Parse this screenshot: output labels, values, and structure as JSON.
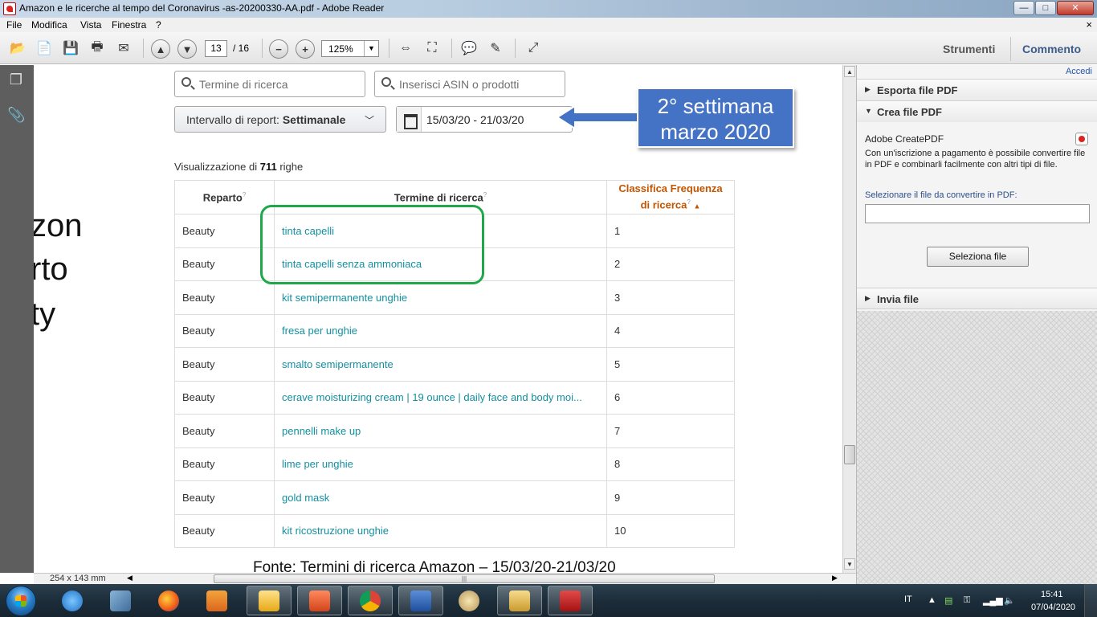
{
  "window": {
    "title": "Amazon e le ricerche al tempo del Coronavirus -as-20200330-AA.pdf - Adobe Reader",
    "controls": {
      "minimize": "—",
      "maximize": "□",
      "close": "✕"
    }
  },
  "menu": {
    "items": [
      "File",
      "Modifica",
      "Vista",
      "Finestra",
      "?"
    ],
    "close_glyph": "×"
  },
  "toolbar": {
    "page_current": "13",
    "page_total": "/ 16",
    "zoom": "125%",
    "tabs": {
      "tools": "Strumenti",
      "comment": "Commento"
    }
  },
  "document": {
    "partial_text": [
      "zon",
      "rto",
      "ty"
    ],
    "search_placeholder": "Termine di ricerca",
    "asin_placeholder": "Inserisci ASIN o prodotti",
    "report_interval_label": "Intervallo di report:",
    "report_interval_value": "Settimanale",
    "date_range": "15/03/20  -  21/03/20",
    "callout": {
      "line1": "2° settimana",
      "line2": "marzo 2020",
      "color": "#4472c4"
    },
    "rows_info": {
      "prefix": "Visualizzazione di",
      "count": "711",
      "suffix": "righe"
    },
    "table": {
      "headers": {
        "department": "Reparto",
        "term": "Termine di ricerca",
        "rank_line1": "Classifica Frequenza",
        "rank_line2": "di ricerca"
      },
      "rows": [
        {
          "department": "Beauty",
          "term": "tinta capelli",
          "rank": "1"
        },
        {
          "department": "Beauty",
          "term": "tinta capelli senza ammoniaca",
          "rank": "2"
        },
        {
          "department": "Beauty",
          "term": "kit semipermanente unghie",
          "rank": "3"
        },
        {
          "department": "Beauty",
          "term": "fresa per unghie",
          "rank": "4"
        },
        {
          "department": "Beauty",
          "term": "smalto semipermanente",
          "rank": "5"
        },
        {
          "department": "Beauty",
          "term": "cerave moisturizing cream | 19 ounce | daily face and body moi...",
          "rank": "6"
        },
        {
          "department": "Beauty",
          "term": "pennelli make up",
          "rank": "7"
        },
        {
          "department": "Beauty",
          "term": "lime per unghie",
          "rank": "8"
        },
        {
          "department": "Beauty",
          "term": "gold mask",
          "rank": "9"
        },
        {
          "department": "Beauty",
          "term": "kit ricostruzione unghie",
          "rank": "10"
        }
      ],
      "term_color": "#138fa0",
      "rank_header_color": "#c45500",
      "highlight_color": "#1fa84a"
    },
    "source": "Fonte: Termini di ricerca Amazon – 15/03/20-21/03/20"
  },
  "statusbar": {
    "page_size": "254 x 143 mm"
  },
  "right_panel": {
    "accedi": "Accedi",
    "sections": {
      "export": "Esporta file PDF",
      "create": "Crea file PDF",
      "send": "Invia file"
    },
    "createpdf_title": "Adobe CreatePDF",
    "createpdf_desc": "Con un'iscrizione a pagamento è possibile convertire file in PDF e combinarli facilmente con altri tipi di file.",
    "select_label": "Selezionare il file da convertire in PDF:",
    "select_button": "Seleziona file"
  },
  "taskbar": {
    "apps": [
      "start-orb",
      "internet-explorer",
      "photo-gallery",
      "firefox",
      "media-player",
      "outlook",
      "powerpoint",
      "chrome",
      "word",
      "paint",
      "file-explorer",
      "adobe-reader"
    ],
    "language": "IT",
    "time": "15:41",
    "date": "07/04/2020"
  }
}
